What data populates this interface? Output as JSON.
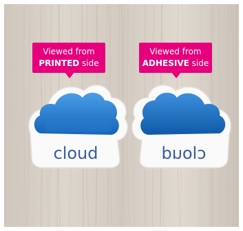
{
  "colors": {
    "callout": "#e6007e",
    "wood_base": "#d9d3cb",
    "sticker_back": "#fafafa",
    "cloud_light": "#4a9de6",
    "cloud_dark": "#1565b8",
    "cloud_text": "#3a5ba0"
  },
  "callouts": [
    {
      "line1": "Viewed from",
      "bold": "PRINTED",
      "rest": " side"
    },
    {
      "line1": "Viewed from",
      "bold": "ADHESIVE",
      "rest": " side"
    }
  ],
  "stickers": [
    {
      "text": "cloud",
      "mirrored": false
    },
    {
      "text": "cloud",
      "mirrored": true
    }
  ]
}
